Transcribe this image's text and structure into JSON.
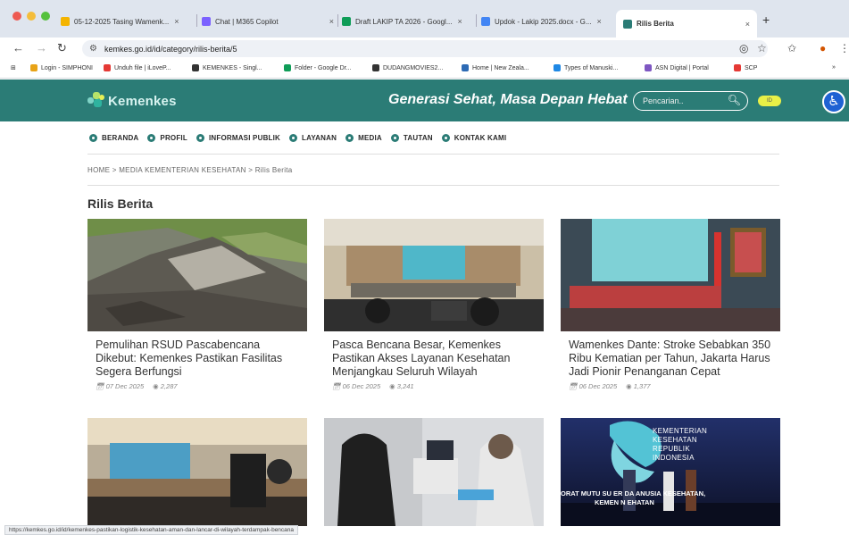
{
  "browser": {
    "tabs": [
      {
        "label": "05-12-2025 Tasing Wamenk...",
        "color": "#f4b400"
      },
      {
        "label": "Chat | M365 Copilot",
        "color": "#7b61ff"
      },
      {
        "label": "Draft LAKIP TA 2026 - Googl...",
        "color": "#0f9d58"
      },
      {
        "label": "Updok - Lakip 2025.docx - G...",
        "color": "#4285f4"
      },
      {
        "label": "Rilis Berita",
        "color": "#2b7c76"
      }
    ],
    "url": "kemkes.go.id/id/category/rilis-berita/5",
    "bookmarks": [
      {
        "label": "Login - SIMPHONI",
        "color": "#e8a317"
      },
      {
        "label": "Unduh file | iLoveP...",
        "color": "#e53935"
      },
      {
        "label": "KEMENKES - Singl...",
        "color": "#333333"
      },
      {
        "label": "Folder - Google Dr...",
        "color": "#0f9d58"
      },
      {
        "label": "DUDANGMOVIES2...",
        "color": "#333333"
      },
      {
        "label": "Home | New Zeala...",
        "color": "#2d6ab4"
      },
      {
        "label": "Types of Manuski...",
        "color": "#1e88e5"
      },
      {
        "label": "ASN Digital | Portal",
        "color": "#7e57c2"
      },
      {
        "label": "SCP",
        "color": "#e53935"
      }
    ],
    "status_url": "https://kemkes.go.id/id/kemenkes-pastikan-logistik-kesehatan-aman-dan-lancar-di-wilayah-terdampak-bencana"
  },
  "site": {
    "logo_text": "Kemenkes",
    "tagline": "Generasi Sehat, Masa Depan Hebat",
    "search_placeholder": "Pencarian..",
    "lang": "ID",
    "nav": [
      "BERANDA",
      "PROFIL",
      "INFORMASI PUBLIK",
      "LAYANAN",
      "MEDIA",
      "TAUTAN",
      "KONTAK KAMI"
    ],
    "breadcrumb": "HOME  > MEDIA KEMENTERIAN KESEHATAN  > Rilis Berita",
    "page_title": "Rilis Berita"
  },
  "articles": [
    {
      "title": "Pemulihan RSUD Pascabencana Dikebut: Kemenkes Pastikan Fasilitas Segera Berfungsi",
      "date": "07 Dec 2025",
      "views": "2,287"
    },
    {
      "title": "Pasca Bencana Besar, Kemenkes Pastikan Akses Layanan Kesehatan Menjangkau Seluruh Wilayah",
      "date": "06 Dec 2025",
      "views": "3,241"
    },
    {
      "title": "Wamenkes Dante: Stroke Sebabkan 350 Ribu Kematian per Tahun, Jakarta Harus Jadi Pionir Penanganan Cepat",
      "date": "06 Dec 2025",
      "views": "1,377"
    }
  ],
  "banner": {
    "line1": "KEMENTERIAN",
    "line2": "KESEHATAN",
    "line3": "REPUBLIK",
    "line4": "INDONESIA",
    "caption": "ORAT MUTU SU    ER DA    ANUSIA KESEHATAN,",
    "caption2": "KEMEN          N          EHATAN"
  }
}
